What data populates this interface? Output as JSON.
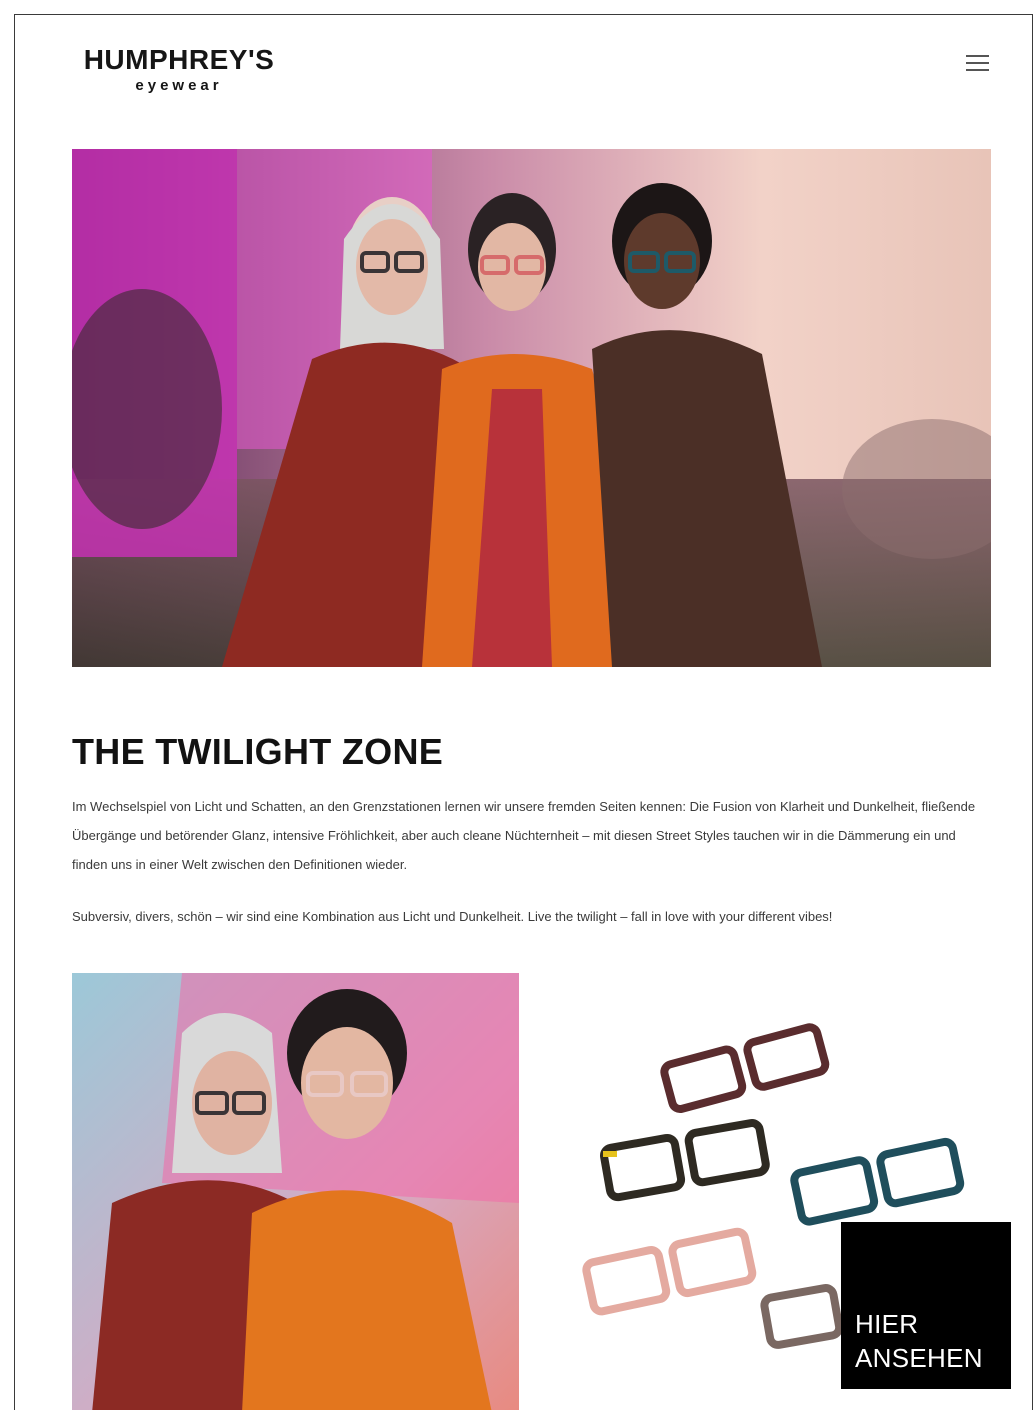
{
  "brand": {
    "name": "HUMPHREY'S",
    "sub": "eyewear"
  },
  "nav": {
    "menu_icon": "hamburger-icon"
  },
  "hero": {
    "alt": "Three models wearing eyewear in twilight street styles"
  },
  "content": {
    "headline": "THE TWILIGHT ZONE",
    "paragraph1": "Im Wechselspiel von Licht und Schatten, an den Grenzstationen lernen wir unsere fremden Seiten kennen: Die Fusion von Klarheit und Dunkelheit, fließende Übergänge und betörender Glanz, intensive Fröhlichkeit, aber auch cleane Nüchternheit – mit diesen Street Styles tauchen wir in die Dämmerung ein und finden uns in einer Welt zwischen den Definitionen wieder.",
    "paragraph2": "Subversiv, divers, schön – wir sind eine Kombination aus Licht und Dunkelheit. Live the twilight – fall in love with your different vibes!"
  },
  "cta": {
    "line1": "HIER",
    "line2": "ANSEHEN"
  },
  "colors": {
    "cta_bg": "#000000",
    "text": "#3a3a3a",
    "accent_pink": "#e040c0",
    "accent_orange": "#e8731e"
  }
}
